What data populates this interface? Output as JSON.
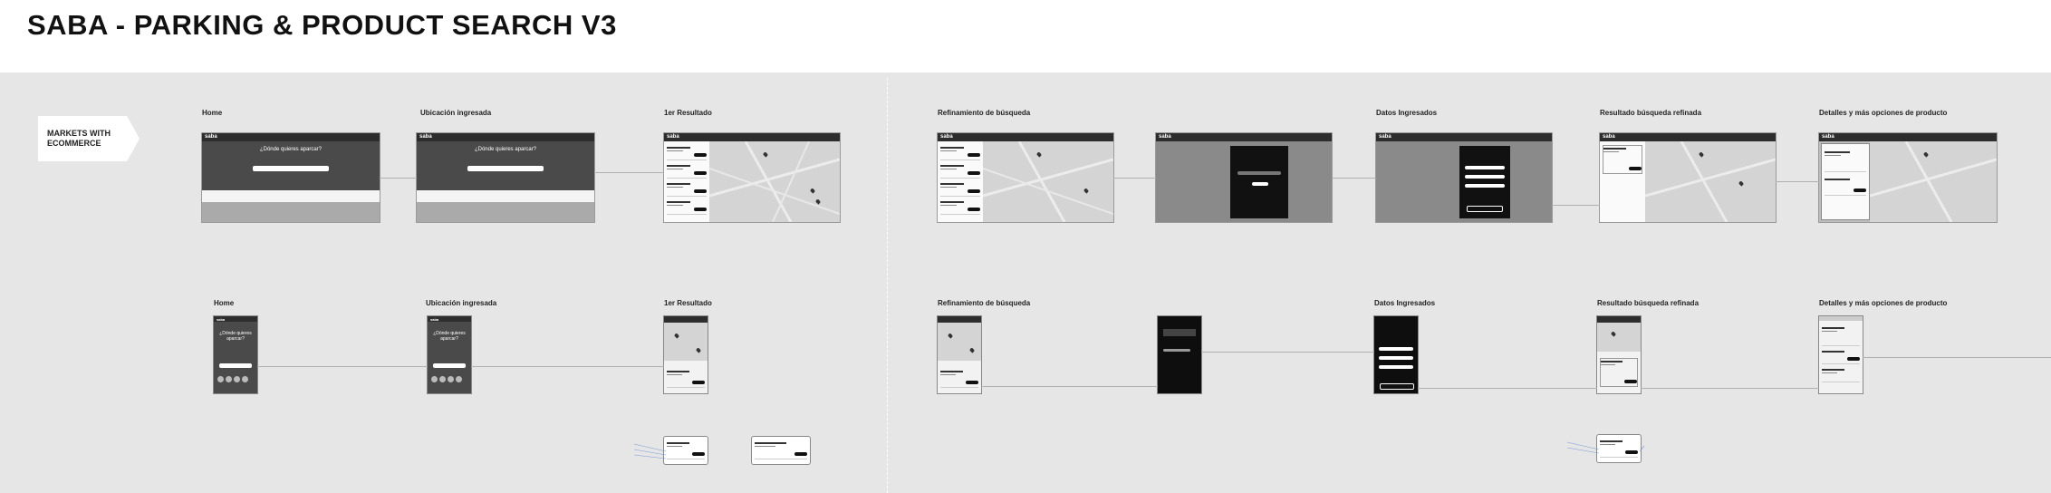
{
  "page": {
    "title": "SABA - PARKING & PRODUCT SEARCH V3",
    "tag": "MARKETS WITH ECOMMERCE",
    "tag_line1": "MARKETS WITH",
    "tag_line2": "ECOMMERCE"
  },
  "desktop_row": {
    "labels": {
      "home": "Home",
      "location": "Ubicación ingresada",
      "first_result": "1er Resultado",
      "refine": "Refinamiento de búsqueda",
      "data_entered": "Datos Ingresados",
      "refined_result": "Resultado búsqueda refinada",
      "details": "Detalles y más opciones de producto"
    }
  },
  "mobile_row": {
    "labels": {
      "home": "Home",
      "location": "Ubicación ingresada",
      "first_result": "1er Resultado",
      "refine": "Refinamiento de búsqueda",
      "data_entered": "Datos Ingresados",
      "refined_result": "Resultado búsqueda refinada",
      "details": "Detalles y más opciones de producto"
    }
  },
  "screens": {
    "logo": "saba",
    "hero_question": "¿Dónde quieres aparcar?",
    "hero_question_mobile_1": "¿Dónde quieres",
    "hero_question_mobile_2": "aparcar?"
  }
}
